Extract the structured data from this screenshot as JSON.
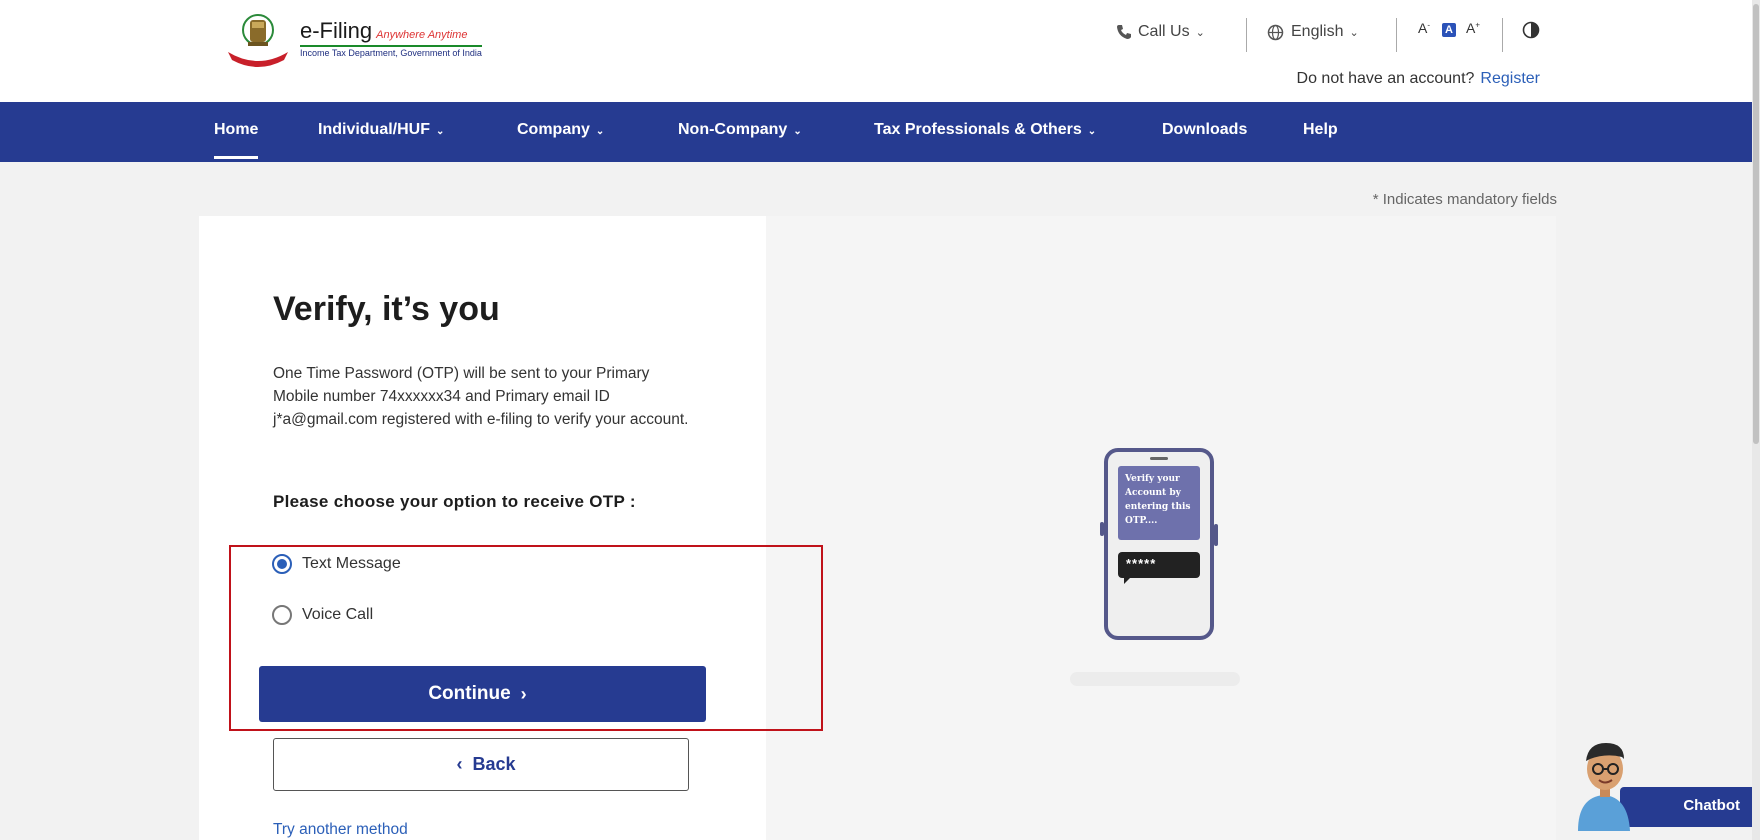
{
  "header": {
    "brand": "e-Filing",
    "tagline": "Anywhere Anytime",
    "department": "Income Tax Department, Government of India",
    "call_us": "Call Us",
    "language": "English",
    "font_decrease": "A",
    "font_default": "A",
    "font_increase": "A",
    "account_prompt": "Do not have an account?",
    "register": "Register"
  },
  "nav": {
    "items": [
      {
        "label": "Home",
        "active": true
      },
      {
        "label": "Individual/HUF",
        "dropdown": true
      },
      {
        "label": "Company",
        "dropdown": true
      },
      {
        "label": "Non-Company",
        "dropdown": true
      },
      {
        "label": "Tax Professionals & Others",
        "dropdown": true
      },
      {
        "label": "Downloads"
      },
      {
        "label": "Help"
      }
    ]
  },
  "mandatory_note": "* Indicates mandatory fields",
  "main": {
    "title": "Verify, it’s you",
    "description": "One Time Password (OTP) will be sent to your Primary Mobile number 74xxxxxx34 and Primary email ID j*a@gmail.com registered with e-filing to verify your account.",
    "choose_label": "Please choose your option to receive OTP :",
    "options": [
      {
        "label": "Text Message",
        "selected": true
      },
      {
        "label": "Voice Call",
        "selected": false
      }
    ],
    "continue_label": "Continue",
    "back_label": "Back",
    "try_another": "Try another method"
  },
  "illustration": {
    "message": "Verify your Account by entering this OTP....",
    "otp_mask": "*****"
  },
  "chatbot": {
    "label": "Chatbot"
  },
  "colors": {
    "primary": "#263b91",
    "link": "#2b5fb8",
    "highlight": "#c0121a"
  }
}
